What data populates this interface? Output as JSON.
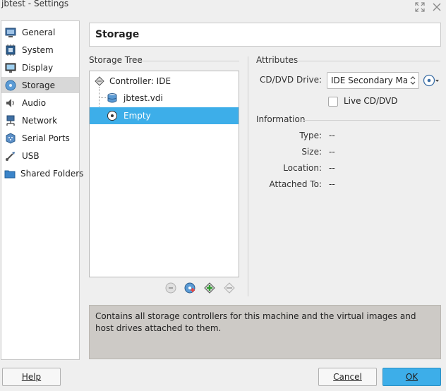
{
  "window": {
    "title": "jbtest - Settings"
  },
  "sidebar": {
    "items": [
      {
        "label": "General",
        "icon": "general-icon"
      },
      {
        "label": "System",
        "icon": "system-icon"
      },
      {
        "label": "Display",
        "icon": "display-icon"
      },
      {
        "label": "Storage",
        "icon": "storage-icon",
        "selected": true
      },
      {
        "label": "Audio",
        "icon": "audio-icon"
      },
      {
        "label": "Network",
        "icon": "network-icon"
      },
      {
        "label": "Serial Ports",
        "icon": "serial-ports-icon"
      },
      {
        "label": "USB",
        "icon": "usb-icon"
      },
      {
        "label": "Shared Folders",
        "icon": "shared-folders-icon"
      }
    ]
  },
  "page": {
    "title": "Storage"
  },
  "storage_tree": {
    "title": "Storage Tree",
    "controller": "Controller: IDE",
    "items": [
      {
        "label": "jbtest.vdi",
        "icon": "hard-disk-icon"
      },
      {
        "label": "Empty",
        "icon": "optical-disc-icon",
        "selected": true
      }
    ]
  },
  "attributes": {
    "title": "Attributes",
    "cd_drive_label": "CD/DVD Drive:",
    "cd_drive_value": "IDE Secondary Master",
    "live_cd_label": "Live CD/DVD",
    "live_cd_checked": false
  },
  "information": {
    "title": "Information",
    "rows": [
      {
        "label": "Type:",
        "value": "--"
      },
      {
        "label": "Size:",
        "value": "--"
      },
      {
        "label": "Location:",
        "value": "--"
      },
      {
        "label": "Attached To:",
        "value": "--"
      }
    ]
  },
  "description": "Contains all storage controllers for this machine and the virtual images and host drives attached to them.",
  "buttons": {
    "help": "Help",
    "cancel": "Cancel",
    "ok": "OK"
  },
  "colors": {
    "selection": "#3daee9",
    "window_bg": "#efefef"
  }
}
